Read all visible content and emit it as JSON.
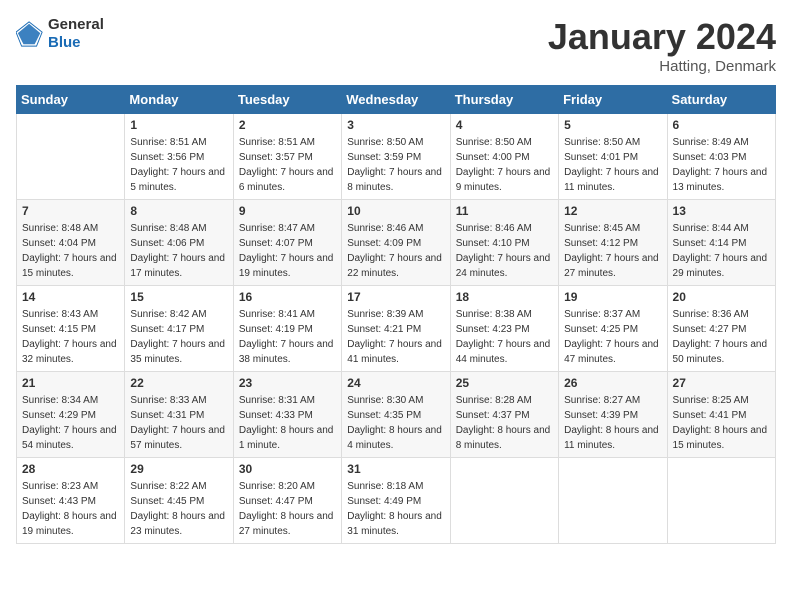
{
  "header": {
    "logo_general": "General",
    "logo_blue": "Blue",
    "month": "January 2024",
    "location": "Hatting, Denmark"
  },
  "weekdays": [
    "Sunday",
    "Monday",
    "Tuesday",
    "Wednesday",
    "Thursday",
    "Friday",
    "Saturday"
  ],
  "weeks": [
    [
      {
        "day": "",
        "sunrise": "",
        "sunset": "",
        "daylight": ""
      },
      {
        "day": "1",
        "sunrise": "Sunrise: 8:51 AM",
        "sunset": "Sunset: 3:56 PM",
        "daylight": "Daylight: 7 hours and 5 minutes."
      },
      {
        "day": "2",
        "sunrise": "Sunrise: 8:51 AM",
        "sunset": "Sunset: 3:57 PM",
        "daylight": "Daylight: 7 hours and 6 minutes."
      },
      {
        "day": "3",
        "sunrise": "Sunrise: 8:50 AM",
        "sunset": "Sunset: 3:59 PM",
        "daylight": "Daylight: 7 hours and 8 minutes."
      },
      {
        "day": "4",
        "sunrise": "Sunrise: 8:50 AM",
        "sunset": "Sunset: 4:00 PM",
        "daylight": "Daylight: 7 hours and 9 minutes."
      },
      {
        "day": "5",
        "sunrise": "Sunrise: 8:50 AM",
        "sunset": "Sunset: 4:01 PM",
        "daylight": "Daylight: 7 hours and 11 minutes."
      },
      {
        "day": "6",
        "sunrise": "Sunrise: 8:49 AM",
        "sunset": "Sunset: 4:03 PM",
        "daylight": "Daylight: 7 hours and 13 minutes."
      }
    ],
    [
      {
        "day": "7",
        "sunrise": "Sunrise: 8:48 AM",
        "sunset": "Sunset: 4:04 PM",
        "daylight": "Daylight: 7 hours and 15 minutes."
      },
      {
        "day": "8",
        "sunrise": "Sunrise: 8:48 AM",
        "sunset": "Sunset: 4:06 PM",
        "daylight": "Daylight: 7 hours and 17 minutes."
      },
      {
        "day": "9",
        "sunrise": "Sunrise: 8:47 AM",
        "sunset": "Sunset: 4:07 PM",
        "daylight": "Daylight: 7 hours and 19 minutes."
      },
      {
        "day": "10",
        "sunrise": "Sunrise: 8:46 AM",
        "sunset": "Sunset: 4:09 PM",
        "daylight": "Daylight: 7 hours and 22 minutes."
      },
      {
        "day": "11",
        "sunrise": "Sunrise: 8:46 AM",
        "sunset": "Sunset: 4:10 PM",
        "daylight": "Daylight: 7 hours and 24 minutes."
      },
      {
        "day": "12",
        "sunrise": "Sunrise: 8:45 AM",
        "sunset": "Sunset: 4:12 PM",
        "daylight": "Daylight: 7 hours and 27 minutes."
      },
      {
        "day": "13",
        "sunrise": "Sunrise: 8:44 AM",
        "sunset": "Sunset: 4:14 PM",
        "daylight": "Daylight: 7 hours and 29 minutes."
      }
    ],
    [
      {
        "day": "14",
        "sunrise": "Sunrise: 8:43 AM",
        "sunset": "Sunset: 4:15 PM",
        "daylight": "Daylight: 7 hours and 32 minutes."
      },
      {
        "day": "15",
        "sunrise": "Sunrise: 8:42 AM",
        "sunset": "Sunset: 4:17 PM",
        "daylight": "Daylight: 7 hours and 35 minutes."
      },
      {
        "day": "16",
        "sunrise": "Sunrise: 8:41 AM",
        "sunset": "Sunset: 4:19 PM",
        "daylight": "Daylight: 7 hours and 38 minutes."
      },
      {
        "day": "17",
        "sunrise": "Sunrise: 8:39 AM",
        "sunset": "Sunset: 4:21 PM",
        "daylight": "Daylight: 7 hours and 41 minutes."
      },
      {
        "day": "18",
        "sunrise": "Sunrise: 8:38 AM",
        "sunset": "Sunset: 4:23 PM",
        "daylight": "Daylight: 7 hours and 44 minutes."
      },
      {
        "day": "19",
        "sunrise": "Sunrise: 8:37 AM",
        "sunset": "Sunset: 4:25 PM",
        "daylight": "Daylight: 7 hours and 47 minutes."
      },
      {
        "day": "20",
        "sunrise": "Sunrise: 8:36 AM",
        "sunset": "Sunset: 4:27 PM",
        "daylight": "Daylight: 7 hours and 50 minutes."
      }
    ],
    [
      {
        "day": "21",
        "sunrise": "Sunrise: 8:34 AM",
        "sunset": "Sunset: 4:29 PM",
        "daylight": "Daylight: 7 hours and 54 minutes."
      },
      {
        "day": "22",
        "sunrise": "Sunrise: 8:33 AM",
        "sunset": "Sunset: 4:31 PM",
        "daylight": "Daylight: 7 hours and 57 minutes."
      },
      {
        "day": "23",
        "sunrise": "Sunrise: 8:31 AM",
        "sunset": "Sunset: 4:33 PM",
        "daylight": "Daylight: 8 hours and 1 minute."
      },
      {
        "day": "24",
        "sunrise": "Sunrise: 8:30 AM",
        "sunset": "Sunset: 4:35 PM",
        "daylight": "Daylight: 8 hours and 4 minutes."
      },
      {
        "day": "25",
        "sunrise": "Sunrise: 8:28 AM",
        "sunset": "Sunset: 4:37 PM",
        "daylight": "Daylight: 8 hours and 8 minutes."
      },
      {
        "day": "26",
        "sunrise": "Sunrise: 8:27 AM",
        "sunset": "Sunset: 4:39 PM",
        "daylight": "Daylight: 8 hours and 11 minutes."
      },
      {
        "day": "27",
        "sunrise": "Sunrise: 8:25 AM",
        "sunset": "Sunset: 4:41 PM",
        "daylight": "Daylight: 8 hours and 15 minutes."
      }
    ],
    [
      {
        "day": "28",
        "sunrise": "Sunrise: 8:23 AM",
        "sunset": "Sunset: 4:43 PM",
        "daylight": "Daylight: 8 hours and 19 minutes."
      },
      {
        "day": "29",
        "sunrise": "Sunrise: 8:22 AM",
        "sunset": "Sunset: 4:45 PM",
        "daylight": "Daylight: 8 hours and 23 minutes."
      },
      {
        "day": "30",
        "sunrise": "Sunrise: 8:20 AM",
        "sunset": "Sunset: 4:47 PM",
        "daylight": "Daylight: 8 hours and 27 minutes."
      },
      {
        "day": "31",
        "sunrise": "Sunrise: 8:18 AM",
        "sunset": "Sunset: 4:49 PM",
        "daylight": "Daylight: 8 hours and 31 minutes."
      },
      {
        "day": "",
        "sunrise": "",
        "sunset": "",
        "daylight": ""
      },
      {
        "day": "",
        "sunrise": "",
        "sunset": "",
        "daylight": ""
      },
      {
        "day": "",
        "sunrise": "",
        "sunset": "",
        "daylight": ""
      }
    ]
  ]
}
